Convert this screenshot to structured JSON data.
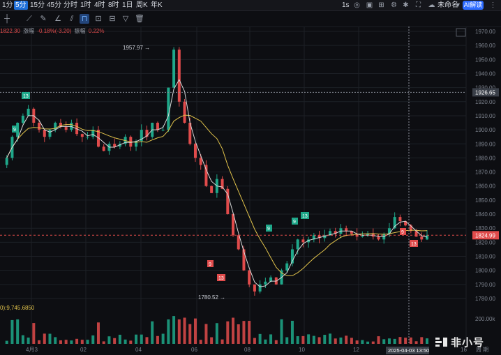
{
  "topbar": {
    "timeframes": [
      "1分",
      "5分",
      "15分",
      "45分",
      "分时",
      "1时",
      "4时",
      "8时",
      "1日",
      "周K",
      "年K"
    ],
    "active_timeframe": "5分",
    "interval": "1s",
    "layout_name": "未命名",
    "ai_button": "AI解读"
  },
  "legend": {
    "price": "1822.30",
    "change_label": "涨幅",
    "change_value": "-0.18%(-3.20)",
    "amp_label": "振幅",
    "amp_value": "0.22%"
  },
  "volume_legend": "0):9,745.6850",
  "watermark": "非小号",
  "colors": {
    "up": "#1fa88a",
    "down": "#e04b4b",
    "ma_short": "#d9d9d9",
    "ma_long": "#e0c24b",
    "bg": "#0d0e12",
    "grid": "#1d2026"
  },
  "chart_data": {
    "type": "candlestick",
    "y_axis_ticks": [
      "1970.00",
      "1960.00",
      "1950.00",
      "1940.00",
      "1930.00",
      "1920.00",
      "1910.00",
      "1900.00",
      "1890.00",
      "1880.00",
      "1870.00",
      "1860.00",
      "1850.00",
      "1840.00",
      "1830.00",
      "1820.00",
      "1810.00",
      "1800.00",
      "1790.00",
      "1780.00"
    ],
    "volume_axis_tick": "200.00k",
    "x_axis_ticks": [
      "4月3",
      "02",
      "04",
      "06",
      "08",
      "10",
      "12",
      "16"
    ],
    "x_axis_last_label": "周 期",
    "crosshair_price": "1926.65",
    "crosshair_time": "2025-04-03 13:50",
    "last_price_label": "1824.99",
    "high_label": "1957.97",
    "low_label": "1780.52",
    "td_markers": [
      {
        "text": "9",
        "color": "up"
      },
      {
        "text": "13",
        "color": "up"
      },
      {
        "text": "9",
        "color": "down"
      },
      {
        "text": "13",
        "color": "down"
      },
      {
        "text": "9",
        "color": "up"
      },
      {
        "text": "9",
        "color": "up"
      },
      {
        "text": "13",
        "color": "up"
      },
      {
        "text": "9",
        "color": "down"
      },
      {
        "text": "13",
        "color": "down"
      }
    ],
    "price_path": [
      1875,
      1880,
      1895,
      1905,
      1910,
      1915,
      1905,
      1900,
      1895,
      1900,
      1905,
      1902,
      1900,
      1905,
      1897,
      1895,
      1895,
      1900,
      1888,
      1885,
      1890,
      1888,
      1890,
      1895,
      1888,
      1892,
      1900,
      1895,
      1905,
      1900,
      1900,
      1930,
      1957,
      1920,
      1905,
      1890,
      1880,
      1875,
      1860,
      1855,
      1865,
      1858,
      1840,
      1825,
      1815,
      1800,
      1790,
      1785,
      1790,
      1792,
      1795,
      1790,
      1800,
      1805,
      1815,
      1822,
      1820,
      1822,
      1825,
      1823,
      1825,
      1828,
      1826,
      1830,
      1828,
      1826,
      1824,
      1825,
      1826,
      1824,
      1822,
      1826,
      1830,
      1838,
      1835,
      1832,
      1828,
      1824,
      1822,
      1825
    ]
  }
}
